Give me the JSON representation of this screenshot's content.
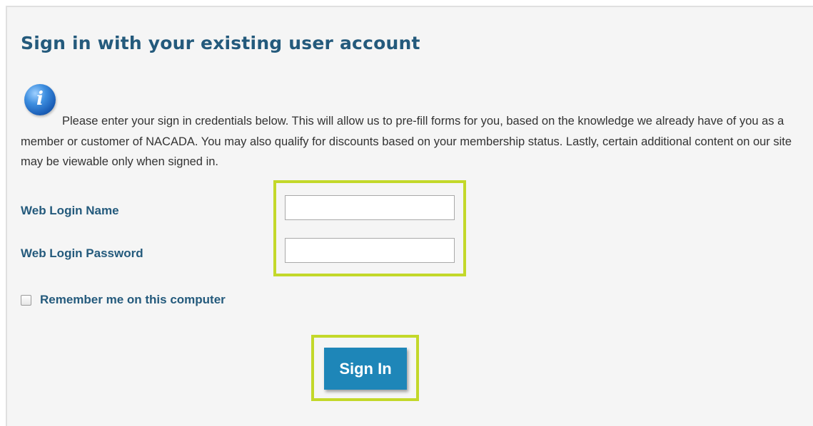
{
  "form": {
    "title": "Sign in with your existing user account",
    "info_icon": "info-icon",
    "intro_text": "Please enter your sign in credentials below. This will allow us to pre-fill forms for you, based on the knowledge we already have of you as a member or customer of NACADA. You may also qualify for discounts based on your membership status. Lastly, certain additional content on our site may be viewable only when signed in.",
    "login_name_label": "Web Login Name",
    "login_name_value": "",
    "password_label": "Web Login Password",
    "password_value": "",
    "remember_label": "Remember me on this computer",
    "remember_checked": false,
    "signin_label": "Sign In"
  },
  "colors": {
    "heading": "#245a7c",
    "button": "#1e86b8",
    "highlight": "#c3d82a",
    "panel_bg": "#f5f5f5"
  }
}
